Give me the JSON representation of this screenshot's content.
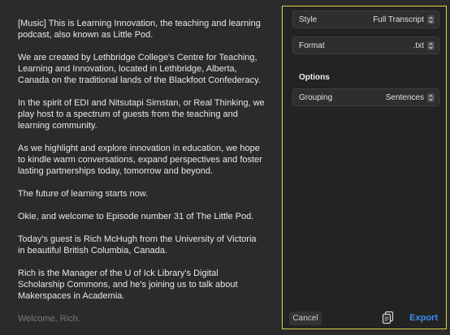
{
  "transcript": {
    "paragraphs": [
      "[Music] This is Learning Innovation, the teaching and learning podcast, also known as Little Pod.",
      "We are created by Lethbridge College's Centre for Teaching, Learning and Innovation, located in Lethbridge, Alberta, Canada on the traditional lands of the Blackfoot Confederacy.",
      "In the spirit of EDI and Nitsutapi Simstan, or Real Thinking, we play host to a spectrum of guests from the teaching and learning community.",
      "As we highlight and explore innovation in education, we hope to kindle warm conversations, expand perspectives and foster lasting partnerships today, tomorrow and beyond.",
      "The future of learning starts now.",
      "Okie, and welcome to Episode number 31 of The Little Pod.",
      "Today's guest is Rich McHugh from the University of Victoria in beautiful British Columbia, Canada.",
      "Rich is the Manager of the U of Ick Library's Digital Scholarship Commons, and he's joining us to talk about Makerspaces in Academia.",
      "Welcome, Rich."
    ]
  },
  "export_panel": {
    "style": {
      "label": "Style",
      "value": "Full Transcript"
    },
    "format": {
      "label": "Format",
      "value": ".txt"
    },
    "options_heading": "Options",
    "grouping": {
      "label": "Grouping",
      "value": "Sentences"
    },
    "cancel_label": "Cancel",
    "export_label": "Export"
  },
  "colors": {
    "panel_border": "#d9d44a",
    "accent": "#3c8ef3"
  },
  "icons": {
    "chevron": "chevron-up-down-icon",
    "copy": "copy-icon"
  }
}
